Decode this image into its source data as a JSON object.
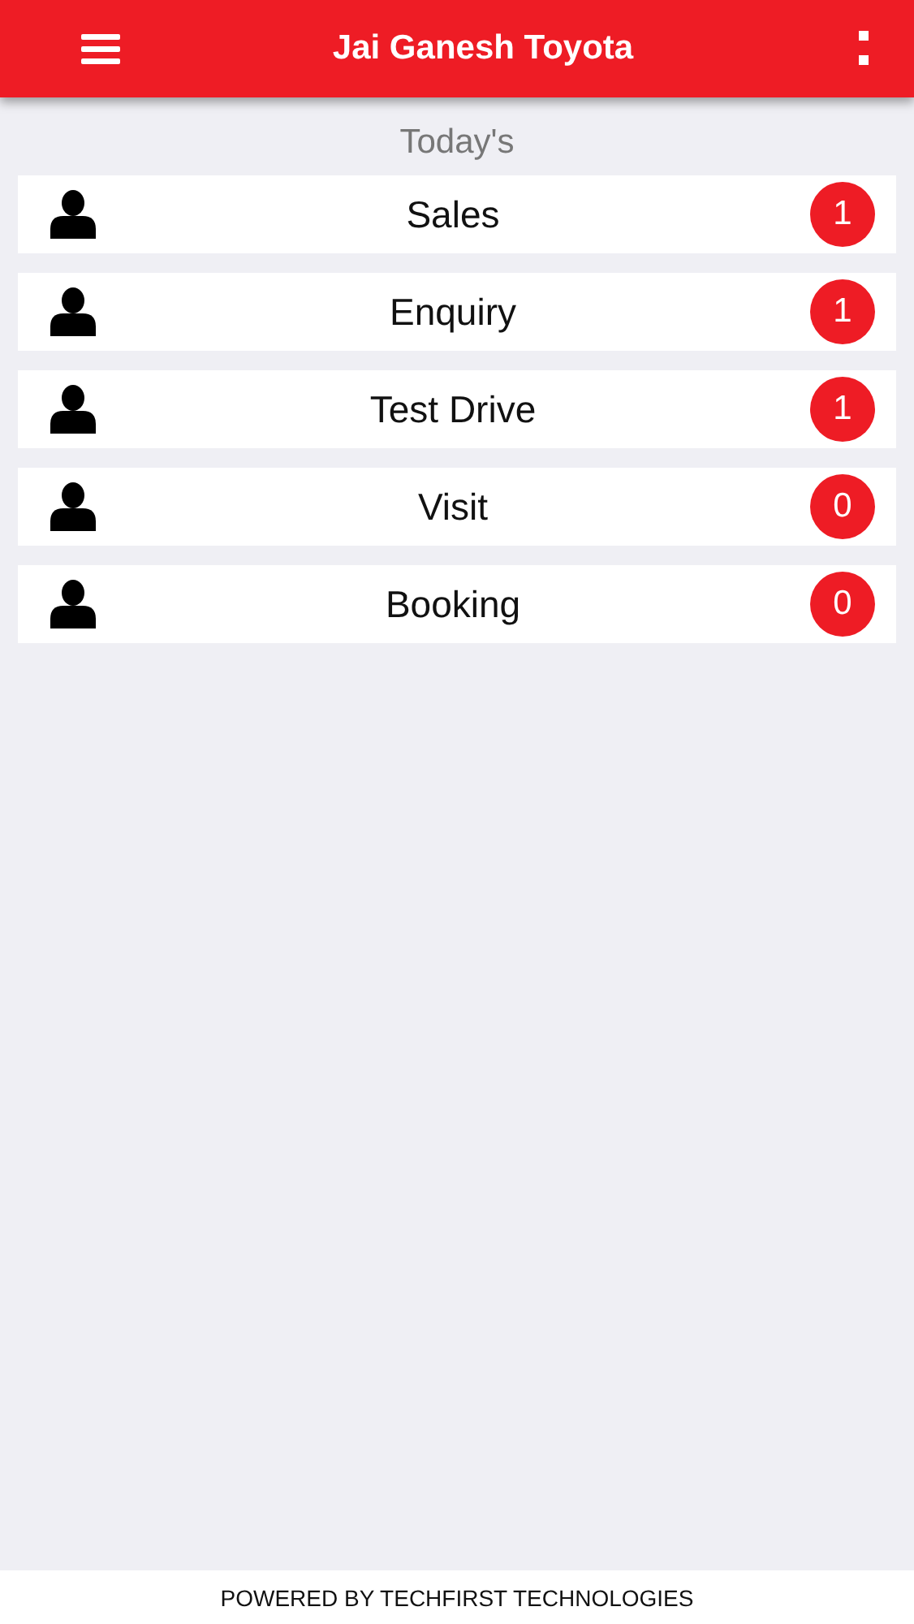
{
  "header": {
    "title": "Jai Ganesh Toyota"
  },
  "section_title": "Today's",
  "items": [
    {
      "label": "Sales",
      "count": "1"
    },
    {
      "label": "Enquiry",
      "count": "1"
    },
    {
      "label": "Test Drive",
      "count": "1"
    },
    {
      "label": "Visit",
      "count": "0"
    },
    {
      "label": "Booking",
      "count": "0"
    }
  ],
  "footer": "POWERED BY TECHFIRST TECHNOLOGIES"
}
